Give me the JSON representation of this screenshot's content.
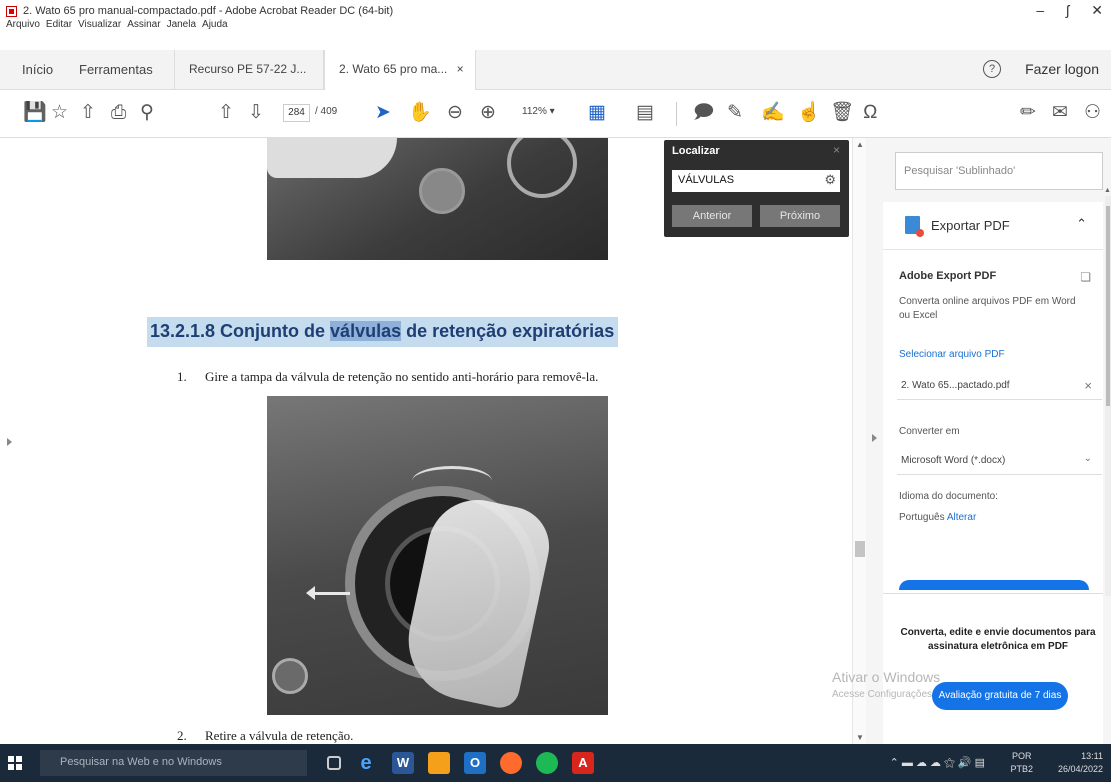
{
  "window": {
    "title": "2. Wato 65 pro manual-compactado.pdf - Adobe Acrobat Reader DC (64-bit)",
    "controls": [
      "–",
      "ʃ",
      "✕"
    ]
  },
  "menu": [
    "Arquivo",
    "Editar",
    "Visualizar",
    "Assinar",
    "Janela",
    "Ajuda"
  ],
  "tabs": {
    "home": "Início",
    "tools": "Ferramentas",
    "doc_tab_1": "Recurso PE 57-22 J...",
    "doc_tab_2": "2. Wato 65 pro ma...",
    "close_glyph": "×",
    "help_glyph": "?",
    "login": "Fazer logon"
  },
  "toolbar": {
    "page_current": "284",
    "page_total": "/ 409",
    "zoom": "112%  ▾"
  },
  "document": {
    "heading_prefix": "13.2.1.8 Conjunto de ",
    "heading_highlight": "válvulas",
    "heading_suffix": " de retenção expiratórias",
    "step1_num": "1.",
    "step1_text": "Gire a tampa da válvula de retenção no sentido anti-horário para removê-la.",
    "step2_num": "2.",
    "step2_text": "Retire a válvula de retenção."
  },
  "find": {
    "title": "Localizar",
    "query": "VÁLVULAS",
    "prev": "Anterior",
    "next": "Próximo"
  },
  "right_pane": {
    "search_placeholder": "Pesquisar 'Sublinhado'",
    "export_title": "Exportar PDF",
    "adobe_export_title": "Adobe Export PDF",
    "export_desc": "Converta online arquivos PDF em Word ou Excel",
    "select_file": "Selecionar arquivo PDF",
    "file_name": "2. Wato 65...pactado.pdf",
    "convert_to_label": "Converter em",
    "format": "Microsoft Word (*.docx)",
    "doc_lang_label": "Idioma do documento:",
    "doc_lang": "Português",
    "change": "Alterar",
    "promo": "Converta, edite e envie documentos para assinatura eletrônica em PDF",
    "trial": "Avaliação gratuita de 7 dias"
  },
  "watermark": {
    "line1": "Ativar o Windows",
    "line2": "Acesse Configurações para ativar o Windows."
  },
  "taskbar": {
    "search": "Pesquisar na Web e no Windows",
    "lang_top": "POR",
    "lang_bottom": "PTB2",
    "time": "13:11",
    "date": "26/04/2022"
  }
}
